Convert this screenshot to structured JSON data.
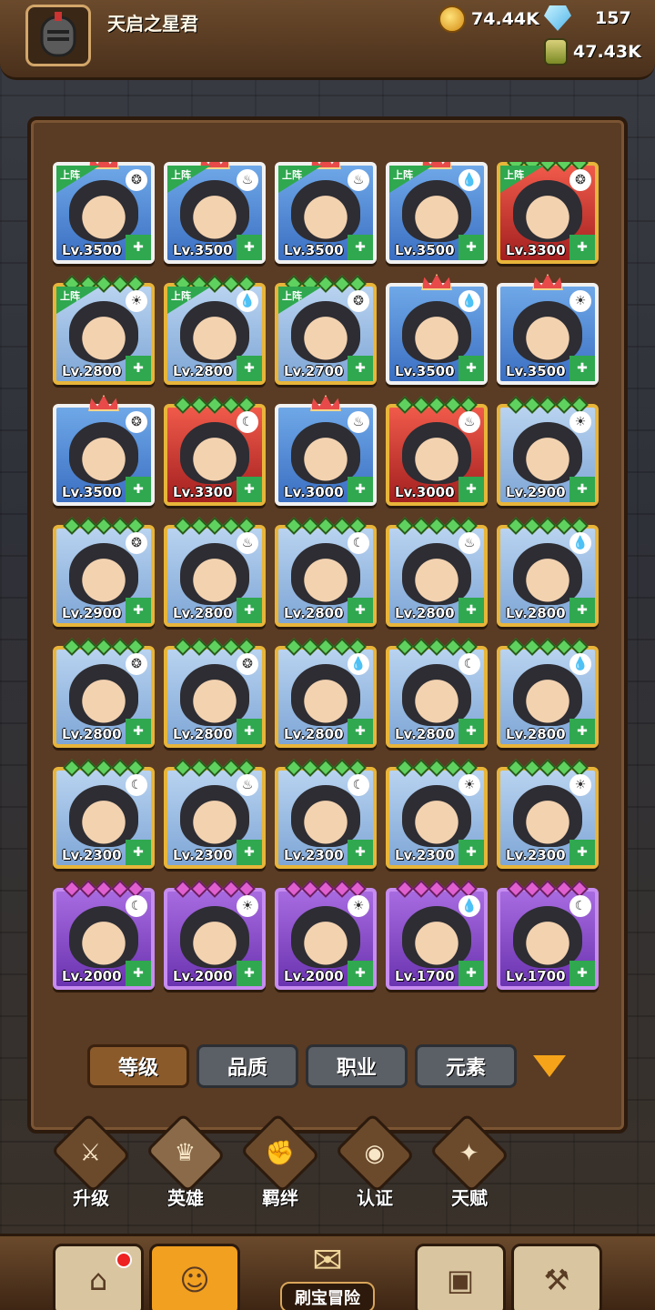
{
  "player": {
    "name": "天启之星君"
  },
  "resources": {
    "gold": "74.44K",
    "gems": "157",
    "potion": "47.43K"
  },
  "heroes": [
    {
      "level": "Lv.3500",
      "frame": "white",
      "deployed": true,
      "elem": "wind"
    },
    {
      "level": "Lv.3500",
      "frame": "white",
      "deployed": true,
      "elem": "fire"
    },
    {
      "level": "Lv.3500",
      "frame": "white",
      "deployed": true,
      "elem": "fire"
    },
    {
      "level": "Lv.3500",
      "frame": "white",
      "deployed": true,
      "elem": "water"
    },
    {
      "level": "Lv.3300",
      "frame": "red",
      "deployed": true,
      "elem": "wind"
    },
    {
      "level": "Lv.2800",
      "frame": "gold",
      "deployed": true,
      "elem": "light"
    },
    {
      "level": "Lv.2800",
      "frame": "gold",
      "deployed": true,
      "elem": "water"
    },
    {
      "level": "Lv.2700",
      "frame": "gold",
      "deployed": true,
      "elem": "wind"
    },
    {
      "level": "Lv.3500",
      "frame": "white",
      "deployed": false,
      "elem": "water"
    },
    {
      "level": "Lv.3500",
      "frame": "white",
      "deployed": false,
      "elem": "light"
    },
    {
      "level": "Lv.3500",
      "frame": "white",
      "deployed": false,
      "elem": "wind"
    },
    {
      "level": "Lv.3300",
      "frame": "red",
      "deployed": false,
      "elem": "dark"
    },
    {
      "level": "Lv.3000",
      "frame": "white",
      "deployed": false,
      "elem": "fire"
    },
    {
      "level": "Lv.3000",
      "frame": "red",
      "deployed": false,
      "elem": "fire"
    },
    {
      "level": "Lv.2900",
      "frame": "gold",
      "deployed": false,
      "elem": "light"
    },
    {
      "level": "Lv.2900",
      "frame": "gold",
      "deployed": false,
      "elem": "wind"
    },
    {
      "level": "Lv.2800",
      "frame": "gold",
      "deployed": false,
      "elem": "fire"
    },
    {
      "level": "Lv.2800",
      "frame": "gold",
      "deployed": false,
      "elem": "dark"
    },
    {
      "level": "Lv.2800",
      "frame": "gold",
      "deployed": false,
      "elem": "fire"
    },
    {
      "level": "Lv.2800",
      "frame": "gold",
      "deployed": false,
      "elem": "water"
    },
    {
      "level": "Lv.2800",
      "frame": "gold",
      "deployed": false,
      "elem": "wind"
    },
    {
      "level": "Lv.2800",
      "frame": "gold",
      "deployed": false,
      "elem": "wind"
    },
    {
      "level": "Lv.2800",
      "frame": "gold",
      "deployed": false,
      "elem": "water"
    },
    {
      "level": "Lv.2800",
      "frame": "gold",
      "deployed": false,
      "elem": "dark"
    },
    {
      "level": "Lv.2800",
      "frame": "gold",
      "deployed": false,
      "elem": "water"
    },
    {
      "level": "Lv.2300",
      "frame": "gold",
      "deployed": false,
      "elem": "dark"
    },
    {
      "level": "Lv.2300",
      "frame": "gold",
      "deployed": false,
      "elem": "fire"
    },
    {
      "level": "Lv.2300",
      "frame": "gold",
      "deployed": false,
      "elem": "dark"
    },
    {
      "level": "Lv.2300",
      "frame": "gold",
      "deployed": false,
      "elem": "light"
    },
    {
      "level": "Lv.2300",
      "frame": "gold",
      "deployed": false,
      "elem": "light"
    },
    {
      "level": "Lv.2000",
      "frame": "purple",
      "deployed": false,
      "elem": "dark"
    },
    {
      "level": "Lv.2000",
      "frame": "purple",
      "deployed": false,
      "elem": "light"
    },
    {
      "level": "Lv.2000",
      "frame": "purple",
      "deployed": false,
      "elem": "light"
    },
    {
      "level": "Lv.1700",
      "frame": "purple",
      "deployed": false,
      "elem": "water"
    },
    {
      "level": "Lv.1700",
      "frame": "purple",
      "deployed": false,
      "elem": "dark"
    }
  ],
  "deploy_label": "上阵",
  "filters": [
    "等级",
    "品质",
    "职业",
    "元素"
  ],
  "subnav": [
    "升级",
    "英雄",
    "羁绊",
    "认证",
    "天赋"
  ],
  "bottom": {
    "center_label": "刷宝冒险"
  },
  "colors": {
    "accent": "#f2a020",
    "panel": "#5a3b23"
  }
}
